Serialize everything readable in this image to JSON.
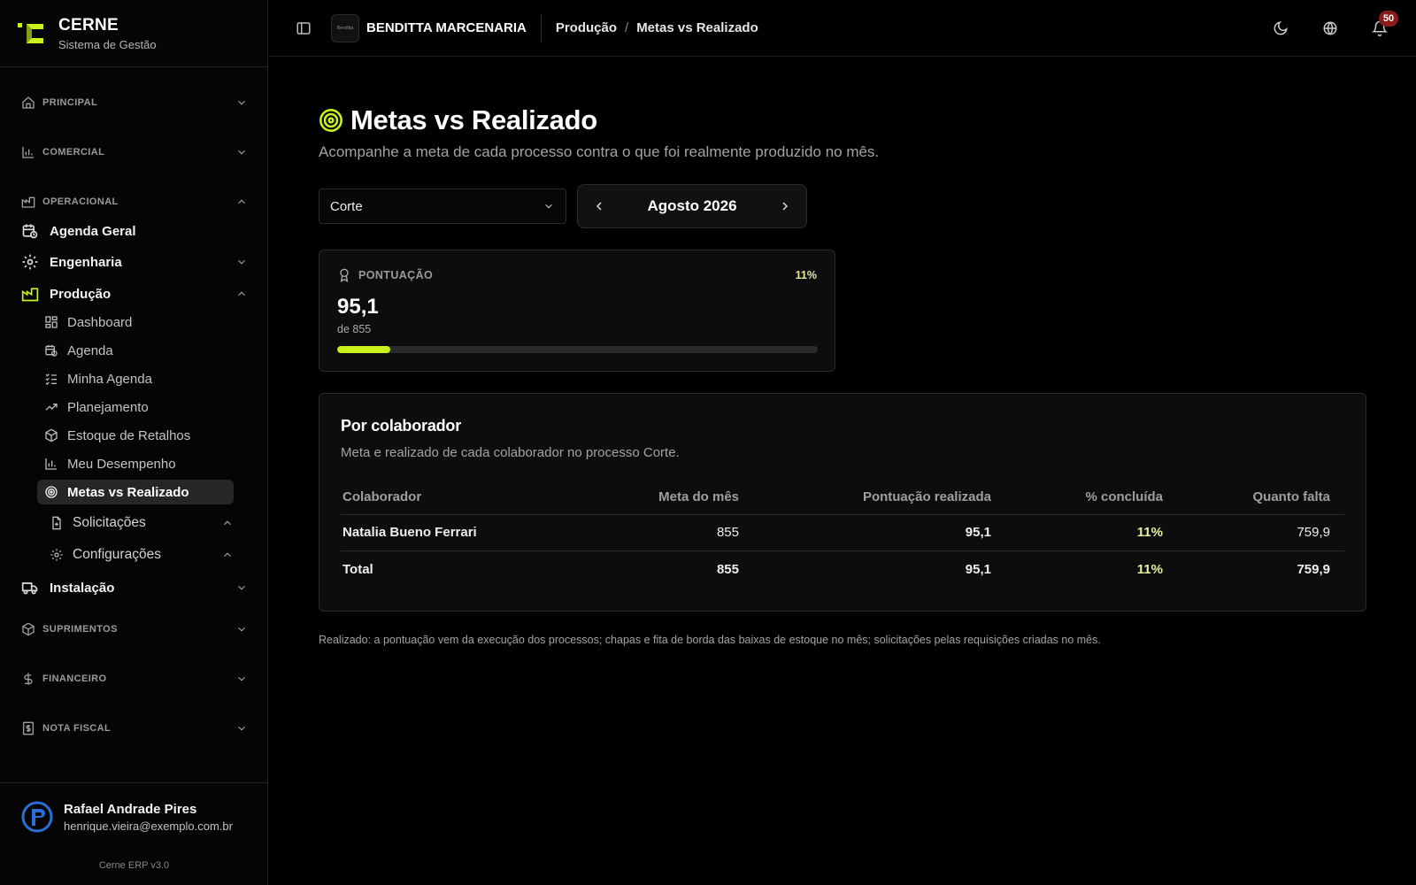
{
  "brand": {
    "name": "CERNE",
    "tagline": "Sistema de Gestão"
  },
  "sidebar": {
    "sections": {
      "principal": "PRINCIPAL",
      "comercial": "COMERCIAL",
      "operacional": "OPERACIONAL",
      "suprimentos": "SUPRIMENTOS",
      "financeiro": "FINANCEIRO",
      "nota_fiscal": "NOTA FISCAL"
    },
    "items": {
      "agenda_geral": "Agenda Geral",
      "engenharia": "Engenharia",
      "producao": "Produção",
      "instalacao": "Instalação"
    },
    "producao_sub": [
      "Dashboard",
      "Agenda",
      "Minha Agenda",
      "Planejamento",
      "Estoque de Retalhos",
      "Meu Desempenho",
      "Metas vs Realizado",
      "Solicitações",
      "Configurações"
    ]
  },
  "user": {
    "name": "Rafael Andrade Pires",
    "email": "henrique.vieira@exemplo.com.br",
    "version": "Cerne ERP v3.0"
  },
  "topbar": {
    "company_name": "BENDITTA MARCENARIA",
    "company_logo_text": "Benditta",
    "breadcrumb_parent": "Produção",
    "breadcrumb_separator": "/",
    "breadcrumb_current": "Metas vs Realizado",
    "notifications_count": "50"
  },
  "page": {
    "title": "Metas vs Realizado",
    "subtitle": "Acompanhe a meta de cada processo contra o que foi realmente produzido no mês.",
    "process_select": "Corte",
    "month_label": "Agosto 2026"
  },
  "score": {
    "label": "PONTUAÇÃO",
    "percent_text": "11%",
    "value": "95,1",
    "of_text": "de 855",
    "progress_fraction": 0.111
  },
  "by_collaborator": {
    "title": "Por colaborador",
    "description": "Meta e realizado de cada colaborador no processo Corte.",
    "columns": [
      "Colaborador",
      "Meta do mês",
      "Pontuação realizada",
      "% concluída",
      "Quanto falta"
    ],
    "rows": [
      {
        "name": "Natalia Bueno Ferrari",
        "meta": "855",
        "realizado": "95,1",
        "pct": "11%",
        "falta": "759,9"
      }
    ],
    "total": {
      "label": "Total",
      "meta": "855",
      "realizado": "95,1",
      "pct": "11%",
      "falta": "759,9"
    }
  },
  "footnote": "Realizado: a pontuação vem da execução dos processos; chapas e fita de borda das baixas de estoque no mês; solicitações pelas requisições criadas no mês.",
  "colors": {
    "accent": "#c8f21a",
    "background": "#000000",
    "card": "#0d0d0d",
    "badge": "#8b1a1a"
  },
  "icons": [
    "logo-icon",
    "home-icon",
    "bar-chart-icon",
    "factory-icon",
    "calendar-clock-icon",
    "gear-icon",
    "dashboard-grid-icon",
    "list-check-icon",
    "trend-up-icon",
    "box-icon",
    "target-icon",
    "file-plus-icon",
    "truck-icon",
    "dollar-icon",
    "receipt-icon",
    "sidebar-toggle-icon",
    "moon-icon",
    "globe-icon",
    "bell-icon",
    "award-icon",
    "chevron-left-icon",
    "chevron-right-icon",
    "chevron-down-icon",
    "chevron-up-icon"
  ]
}
